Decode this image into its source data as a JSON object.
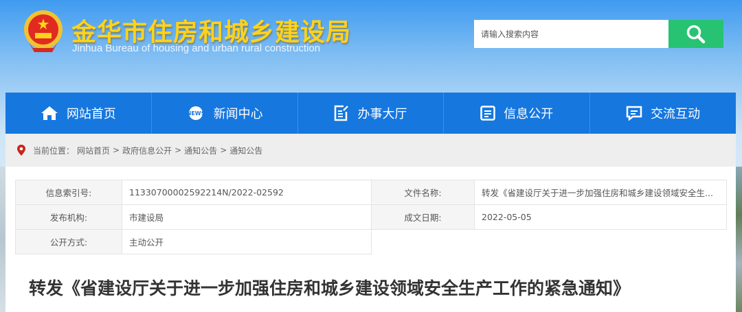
{
  "header": {
    "title_cn": "金华市住房和城乡建设局",
    "title_en": "Jinhua Bureau of housing and urban rural construction",
    "search_placeholder": "请输入搜索内容",
    "search_icon": "search-icon"
  },
  "nav": [
    {
      "label": "网站首页",
      "icon": "home-icon"
    },
    {
      "label": "新闻中心",
      "icon": "news-icon"
    },
    {
      "label": "办事大厅",
      "icon": "edit-document-icon"
    },
    {
      "label": "信息公开",
      "icon": "info-board-icon"
    },
    {
      "label": "交流互动",
      "icon": "chat-icon"
    }
  ],
  "breadcrumb": {
    "prefix": "当前位置：",
    "items": [
      "网站首页",
      "政府信息公开",
      "通知公告",
      "通知公告"
    ],
    "sep": ">"
  },
  "meta": {
    "index_label": "信息索引号:",
    "index_value": "11330700002592214N/2022-02592",
    "file_label": "文件名称:",
    "file_value": "转发《省建设厅关于进一步加强住房和城乡建设领域安全生...",
    "org_label": "发布机构:",
    "org_value": "市建设局",
    "date_label": "成文日期:",
    "date_value": "2022-05-05",
    "mode_label": "公开方式:",
    "mode_value": "主动公开"
  },
  "article": {
    "title": "转发《省建设厅关于进一步加强住房和城乡建设领域安全生产工作的紧急通知》"
  },
  "colors": {
    "nav": "#1677df",
    "search_button": "#27c373",
    "title_text": "#ffd21c"
  }
}
